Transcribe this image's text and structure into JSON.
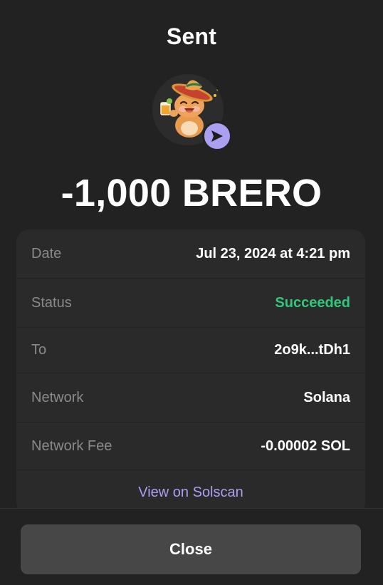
{
  "header": {
    "title": "Sent"
  },
  "token": {
    "icon": "hamster-sombrero-token-icon",
    "badge_icon": "send-arrow-icon"
  },
  "amount": "-1,000 BRERO",
  "details": {
    "date": {
      "label": "Date",
      "value": "Jul 23, 2024 at 4:21 pm"
    },
    "status": {
      "label": "Status",
      "value": "Succeeded"
    },
    "to": {
      "label": "To",
      "value": "2o9k...tDh1"
    },
    "network": {
      "label": "Network",
      "value": "Solana"
    },
    "fee": {
      "label": "Network Fee",
      "value": "-0.00002 SOL"
    },
    "explorer_link": "View on Solscan"
  },
  "footer": {
    "close_label": "Close"
  },
  "colors": {
    "background": "#222222",
    "card": "#2a2a2a",
    "accent": "#ab9ff2",
    "success": "#2ec97a",
    "button": "#474747"
  }
}
